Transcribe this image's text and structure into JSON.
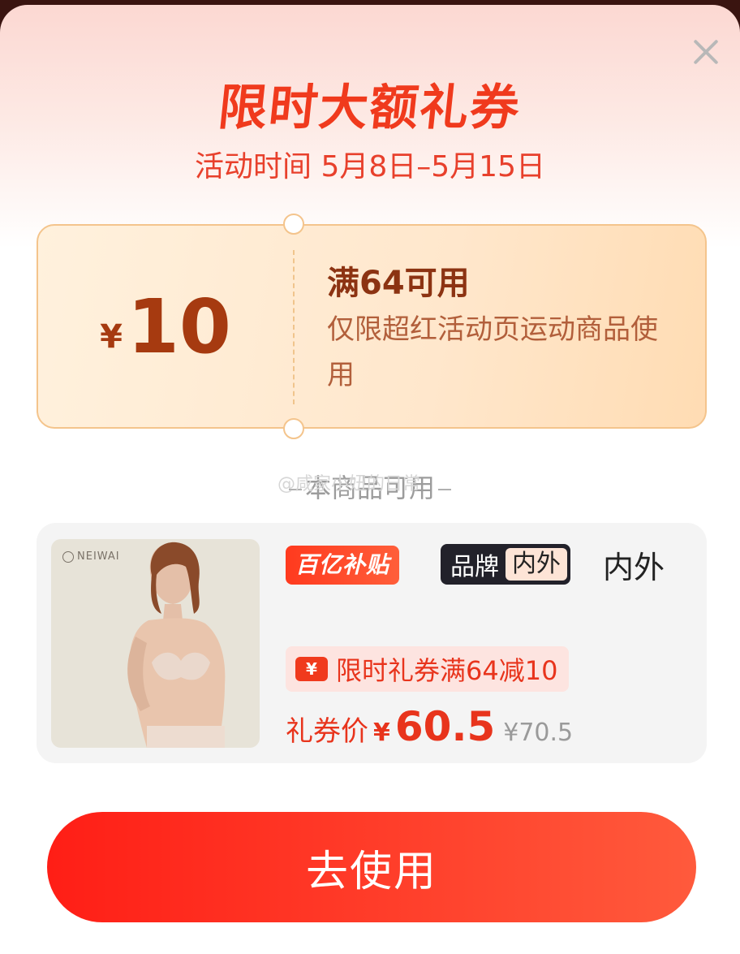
{
  "modal": {
    "title": "限时大额礼券",
    "subtitle": "活动时间 5月8日–5月15日",
    "close_icon": "close-icon"
  },
  "coupon": {
    "currency": "¥",
    "amount": "10",
    "condition": "满64可用",
    "description": "仅限超红活动页运动商品使用"
  },
  "section": {
    "label": "本商品可用",
    "watermark": "@咸家小妞的日常"
  },
  "product": {
    "brand_logo_text": "NEIWAI",
    "subsidy_tag": "百亿补贴",
    "brand_tag_label": "品牌",
    "brand_tag_name": "内外",
    "name": "内外",
    "coupon_icon_text": "¥",
    "promo_text": "限时礼券满64减10",
    "price_label": "礼券价",
    "price_currency": "¥",
    "price": "60.5",
    "original_price": "¥70.5"
  },
  "button": {
    "label": "去使用"
  },
  "colors": {
    "accent_red": "#f03a1d",
    "coupon_brown": "#a63a10",
    "button_gradient_start": "#ff1e16",
    "button_gradient_end": "#ff5a3c"
  }
}
